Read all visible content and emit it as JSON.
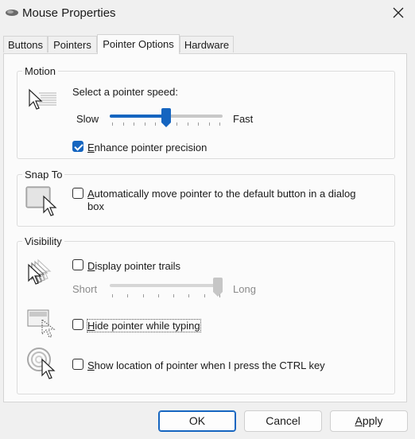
{
  "window": {
    "title": "Mouse Properties",
    "icon": "mouse-icon",
    "close_icon": "close-icon"
  },
  "tabs": [
    {
      "label": "Buttons",
      "active": false
    },
    {
      "label": "Pointers",
      "active": false
    },
    {
      "label": "Pointer Options",
      "active": true
    },
    {
      "label": "Hardware",
      "active": false
    }
  ],
  "motion": {
    "legend": "Motion",
    "icon": "pointer-speed-icon",
    "speed_label": "Select a pointer speed:",
    "slow_label": "Slow",
    "fast_label": "Fast",
    "speed_value_fraction": 0.5,
    "enhance_precision": {
      "label": "Enhance pointer precision",
      "checked": true
    }
  },
  "snap_to": {
    "legend": "Snap To",
    "icon": "snap-to-icon",
    "option": {
      "label_line1": "Automatically move pointer to the default button in a dialog",
      "label_line2": "box",
      "checked": false
    }
  },
  "visibility": {
    "legend": "Visibility",
    "trails_icon": "pointer-trails-icon",
    "trails": {
      "label": "Display pointer trails",
      "checked": false
    },
    "short_label": "Short",
    "long_label": "Long",
    "trails_value_fraction": 1.0,
    "trails_enabled": false,
    "hide_icon": "hide-pointer-icon",
    "hide_while_typing": {
      "label": "Hide pointer while typing",
      "checked": false
    },
    "ctrl_icon": "show-location-icon",
    "show_location": {
      "label": "Show location of pointer when I press the CTRL key",
      "checked": false
    }
  },
  "buttons": {
    "ok": "OK",
    "cancel": "Cancel",
    "apply": "Apply"
  },
  "colors": {
    "accent": "#1565c0",
    "window_bg": "#f0f0f0",
    "panel_bg": "#fbfbfb"
  }
}
